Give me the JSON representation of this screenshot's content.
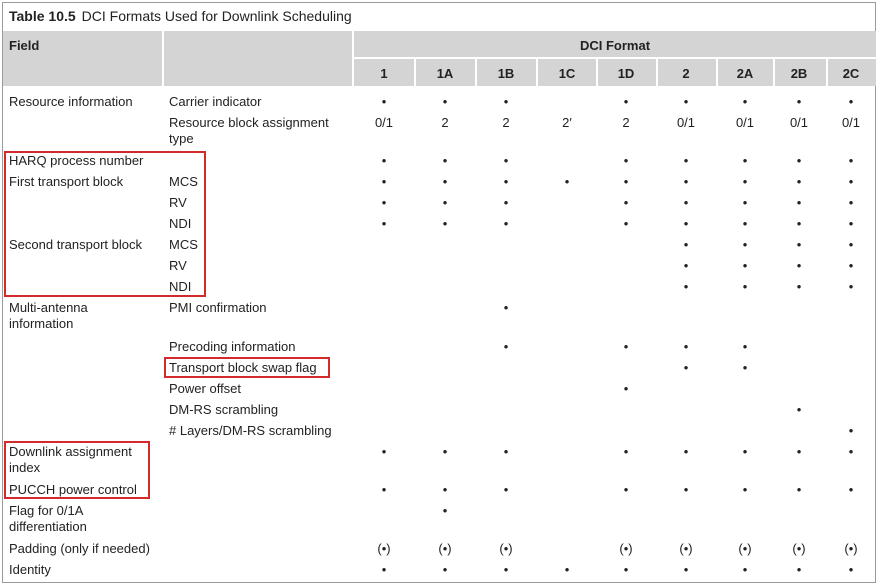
{
  "title": {
    "label": "Table 10.5",
    "text": "DCI Formats Used for Downlink Scheduling"
  },
  "header": {
    "field": "Field",
    "dci_format": "DCI Format",
    "formats": [
      "1",
      "1A",
      "1B",
      "1C",
      "1D",
      "2",
      "2A",
      "2B",
      "2C"
    ]
  },
  "rows": [
    {
      "group": "Resource information",
      "field": "Carrier indicator",
      "values": [
        "•",
        "•",
        "•",
        "",
        "•",
        "•",
        "•",
        "•",
        "•"
      ]
    },
    {
      "group": "",
      "field": "Resource block assignment\ntype",
      "values": [
        "0/1",
        "2",
        "2",
        "2′",
        "2",
        "0/1",
        "0/1",
        "0/1",
        "0/1"
      ]
    },
    {
      "group": "HARQ process number",
      "field": "",
      "values": [
        "•",
        "•",
        "•",
        "",
        "•",
        "•",
        "•",
        "•",
        "•"
      ]
    },
    {
      "group": "First transport block",
      "field": "MCS",
      "values": [
        "•",
        "•",
        "•",
        "•",
        "•",
        "•",
        "•",
        "•",
        "•"
      ]
    },
    {
      "group": "",
      "field": "RV",
      "values": [
        "•",
        "•",
        "•",
        "",
        "•",
        "•",
        "•",
        "•",
        "•"
      ]
    },
    {
      "group": "",
      "field": "NDI",
      "values": [
        "•",
        "•",
        "•",
        "",
        "•",
        "•",
        "•",
        "•",
        "•"
      ]
    },
    {
      "group": "Second transport block",
      "field": "MCS",
      "values": [
        "",
        "",
        "",
        "",
        "",
        "•",
        "•",
        "•",
        "•"
      ]
    },
    {
      "group": "",
      "field": "RV",
      "values": [
        "",
        "",
        "",
        "",
        "",
        "•",
        "•",
        "•",
        "•"
      ]
    },
    {
      "group": "",
      "field": "NDI",
      "values": [
        "",
        "",
        "",
        "",
        "",
        "•",
        "•",
        "•",
        "•"
      ]
    },
    {
      "group": "Multi-antenna\ninformation",
      "field": "PMI confirmation",
      "values": [
        "",
        "",
        "•",
        "",
        "",
        "",
        "",
        "",
        ""
      ]
    },
    {
      "group": "",
      "field": "Precoding information",
      "values": [
        "",
        "",
        "•",
        "",
        "•",
        "•",
        "•",
        "",
        ""
      ]
    },
    {
      "group": "",
      "field": "Transport block swap flag",
      "values": [
        "",
        "",
        "",
        "",
        "",
        "•",
        "•",
        "",
        ""
      ]
    },
    {
      "group": "",
      "field": "Power offset",
      "values": [
        "",
        "",
        "",
        "",
        "•",
        "",
        "",
        "",
        ""
      ]
    },
    {
      "group": "",
      "field": "DM-RS scrambling",
      "values": [
        "",
        "",
        "",
        "",
        "",
        "",
        "",
        "•",
        ""
      ]
    },
    {
      "group": "",
      "field": "# Layers/DM-RS scrambling",
      "values": [
        "",
        "",
        "",
        "",
        "",
        "",
        "",
        "",
        "•"
      ]
    },
    {
      "group": "Downlink assignment\nindex",
      "field": "",
      "values": [
        "•",
        "•",
        "•",
        "",
        "•",
        "•",
        "•",
        "•",
        "•"
      ]
    },
    {
      "group": "PUCCH power control",
      "field": "",
      "values": [
        "•",
        "•",
        "•",
        "",
        "•",
        "•",
        "•",
        "•",
        "•"
      ]
    },
    {
      "group": "Flag for 0/1A\ndifferentiation",
      "field": "",
      "values": [
        "",
        "•",
        "",
        "",
        "",
        "",
        "",
        "",
        ""
      ]
    },
    {
      "group": "Padding (only if needed)",
      "field": "",
      "values": [
        "(•)",
        "(•)",
        "(•)",
        "",
        "(•)",
        "(•)",
        "(•)",
        "(•)",
        "(•)"
      ]
    },
    {
      "group": "Identity",
      "field": "",
      "values": [
        "•",
        "•",
        "•",
        "•",
        "•",
        "•",
        "•",
        "•",
        "•"
      ]
    }
  ],
  "highlight_color": "#d42a2a"
}
